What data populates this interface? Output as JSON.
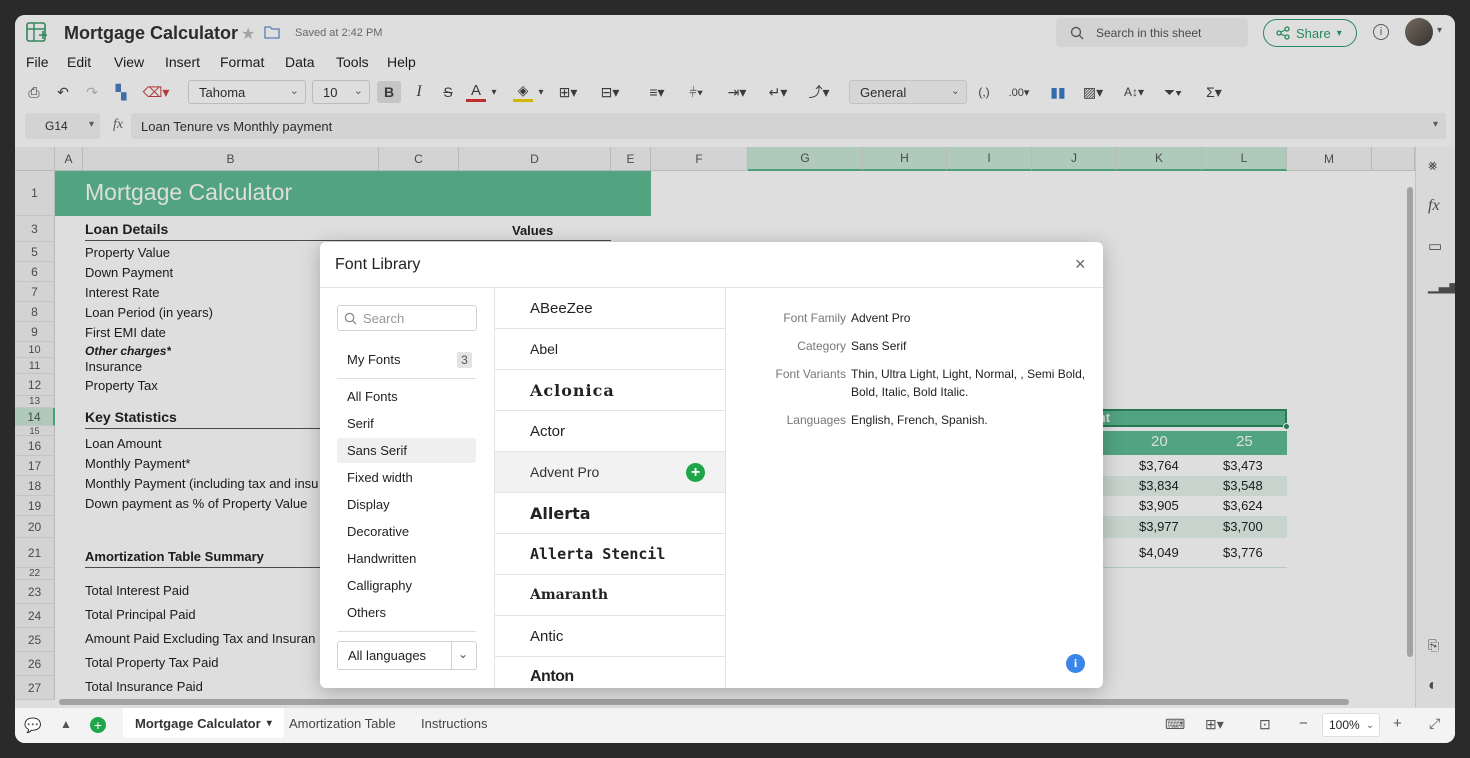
{
  "app": {
    "title": "Mortgage Calculator",
    "saved_status": "Saved at 2:42 PM",
    "search_placeholder": "Search in this sheet",
    "share_label": "Share"
  },
  "menu": [
    "File",
    "Edit",
    "View",
    "Insert",
    "Format",
    "Data",
    "Tools",
    "Help"
  ],
  "toolbar": {
    "font_name": "Tahoma",
    "font_size": "10",
    "bold": "B",
    "italic": "I",
    "strike": "S",
    "text_color": "A",
    "number_format": "General"
  },
  "formula_bar": {
    "cell_ref": "G14",
    "fx": "fx",
    "content": "Loan Tenure vs Monthly payment"
  },
  "columns": [
    "A",
    "B",
    "C",
    "D",
    "E",
    "F",
    "G",
    "H",
    "I",
    "J",
    "K",
    "L",
    "M"
  ],
  "rows": [
    "1",
    "3",
    "5",
    "6",
    "7",
    "8",
    "9",
    "10",
    "11",
    "12",
    "13",
    "14",
    "15",
    "16",
    "17",
    "18",
    "19",
    "20",
    "21",
    "22",
    "23",
    "24",
    "25",
    "26",
    "27"
  ],
  "sheet": {
    "banner_title": "Mortgage Calculator",
    "loan_details_header": "Loan Details",
    "values_header": "Values",
    "loan_details": [
      "Property Value",
      "Down Payment",
      "Interest Rate",
      "Loan Period (in years)",
      "First EMI date"
    ],
    "other_charges": "Other charges*",
    "insurance": "Insurance",
    "property_tax": "Property Tax",
    "key_stats_header": "Key Statistics",
    "key_stats": [
      "Loan Amount",
      "Monthly Payment*",
      "Monthly Payment (including tax and insu",
      "Down payment as % of Property Value"
    ],
    "amort_header": "Amortization Table Summary",
    "amort_items": [
      "Total Interest Paid",
      "Total Principal Paid",
      "Amount Paid Excluding Tax and Insuran",
      "Total Property Tax Paid",
      "Total Insurance Paid"
    ],
    "right_table_title": "ment",
    "right_table_cols": [
      "20",
      "25"
    ],
    "right_table_rows": [
      [
        "$3,764",
        "$3,473"
      ],
      [
        "$3,834",
        "$3,548"
      ],
      [
        "$3,905",
        "$3,624"
      ],
      [
        "$3,977",
        "$3,700"
      ],
      [
        "$4,049",
        "$3,776"
      ]
    ]
  },
  "dialog": {
    "title": "Font Library",
    "search_placeholder": "Search",
    "my_fonts_label": "My Fonts",
    "my_fonts_count": "3",
    "categories": [
      "All Fonts",
      "Serif",
      "Sans Serif",
      "Fixed width",
      "Display",
      "Decorative",
      "Handwritten",
      "Calligraphy",
      "Others"
    ],
    "active_category": "Sans Serif",
    "language_select": "All languages",
    "fonts": [
      "ABeeZee",
      "Abel",
      "Aclonica",
      "Actor",
      "Advent Pro",
      "Allerta",
      "Allerta Stencil",
      "Amaranth",
      "Antic",
      "Anton"
    ],
    "details": {
      "family_label": "Font Family",
      "family_value": "Advent Pro",
      "category_label": "Category",
      "category_value": "Sans Serif",
      "variants_label": "Font Variants",
      "variants_value": "Thin, Ultra Light, Light, Normal, , Semi Bold, Bold, Italic, Bold Italic.",
      "languages_label": "Languages",
      "languages_value": "English, French, Spanish."
    }
  },
  "sheet_tabs": [
    "Mortgage Calculator",
    "Amortization Table",
    "Instructions"
  ],
  "zoom": "100%",
  "colors": {
    "accent_green": "#5dbd92",
    "share_green": "#2e9e6a",
    "add_green": "#1fa64a",
    "info_blue": "#3a86e8"
  }
}
